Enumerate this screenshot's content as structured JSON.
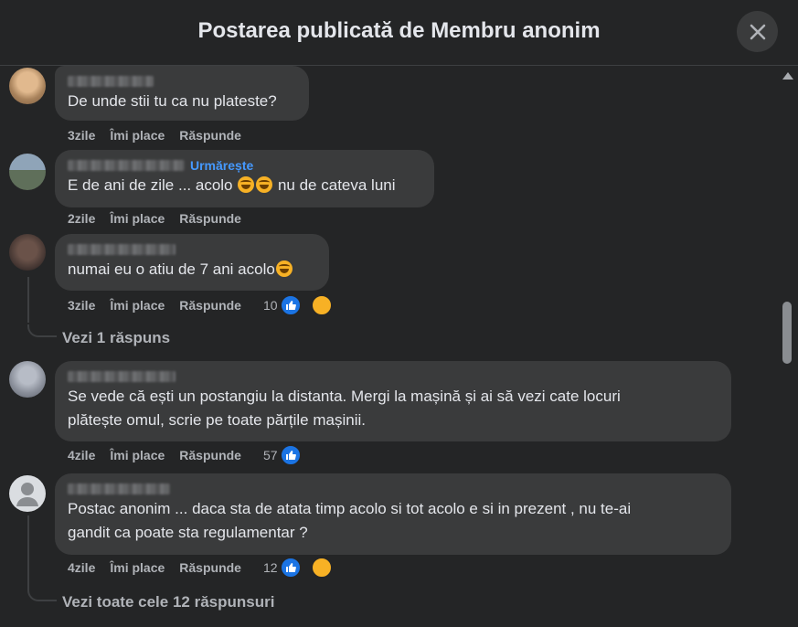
{
  "header": {
    "title": "Postarea publicată de Membru anonim"
  },
  "actions": {
    "like": "Îmi place",
    "reply": "Răspunde"
  },
  "comments": [
    {
      "text": "De unde stii tu ca nu plateste?",
      "time": "3zile",
      "avatar_color": "#c9a27a"
    },
    {
      "follow": "Urmărește",
      "text_before": "E de ani de zile ... acolo",
      "text_after": " nu de cateva luni",
      "time": "2zile",
      "avatar_color": "#6b7f8e"
    },
    {
      "text": "numai eu o atiu de 7 ani acolo",
      "time": "3zile",
      "reaction_count": "10",
      "view_replies": "Vezi 1 răspuns",
      "avatar_color": "#5a4a44"
    },
    {
      "line1": "Se vede că ești un postangiu la distanta. Mergi la mașină și ai să vezi cate locuri",
      "line2": "plătește omul, scrie pe toate părțile mașinii.",
      "time": "4zile",
      "reaction_count": "57",
      "avatar_color": "#8d96a6"
    },
    {
      "line1": "Postac anonim ... daca sta de atata timp acolo si tot acolo e si in prezent , nu te-ai",
      "line2": "gandit ca poate sta regulamentar ?",
      "time": "4zile",
      "reaction_count": "12",
      "view_replies": "Vezi toate cele 12 răspunsuri",
      "avatar_color": "#dadde1"
    }
  ],
  "colors": {
    "like_blue": "#1b74e4",
    "link_blue": "#4599ff",
    "bubble": "#3a3b3c",
    "background": "#242526"
  },
  "icons": [
    "close-icon",
    "like-icon",
    "haha-icon",
    "sad-icon",
    "scroll-up-arrow-icon"
  ]
}
